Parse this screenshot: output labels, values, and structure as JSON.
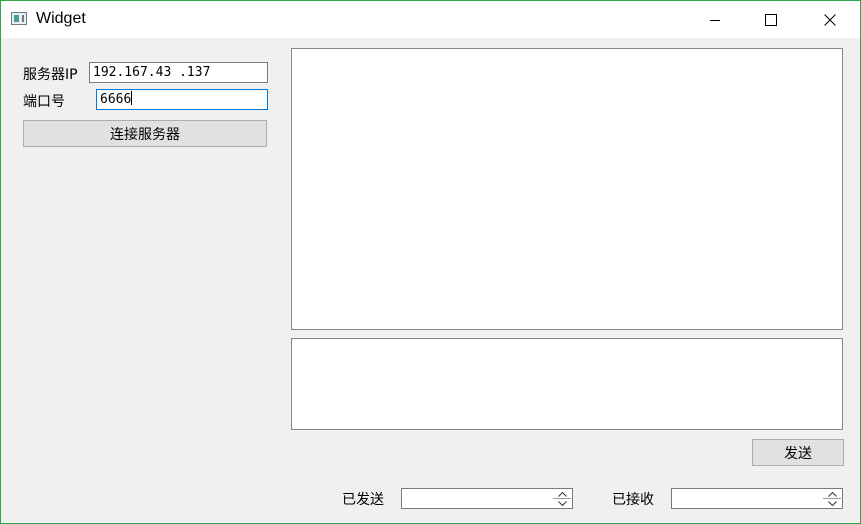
{
  "window": {
    "title": "Widget"
  },
  "connection": {
    "ip_label": "服务器IP",
    "ip_value": "192.167.43 .137",
    "port_label": "端口号",
    "port_value": "6666",
    "connect_label": "连接服务器"
  },
  "chat": {
    "send_label": "发送"
  },
  "stats": {
    "sent_label": "已发送",
    "sent_value": "",
    "received_label": "已接收",
    "received_value": ""
  },
  "colors": {
    "window_border": "#2ca84a",
    "focus_border": "#0078d7"
  }
}
